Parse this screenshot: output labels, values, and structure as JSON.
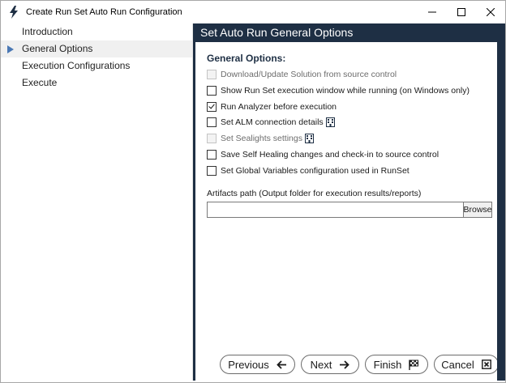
{
  "window": {
    "title": "Create Run Set Auto Run Configuration",
    "controls": [
      "minimize-icon",
      "maximize-icon",
      "close-icon"
    ]
  },
  "sidebar": {
    "items": [
      {
        "label": "Introduction",
        "active": false
      },
      {
        "label": "General Options",
        "active": true
      },
      {
        "label": "Execution Configurations",
        "active": false
      },
      {
        "label": "Execute",
        "active": false
      }
    ]
  },
  "main": {
    "header": "Set Auto Run General Options",
    "section_title": "General Options:",
    "options": [
      {
        "label": "Download/Update Solution from source control",
        "checked": false,
        "disabled": true
      },
      {
        "label": "Show Run Set execution window while running (on Windows only)",
        "checked": false,
        "disabled": false
      },
      {
        "label": "Run Analyzer before execution",
        "checked": true,
        "disabled": false
      },
      {
        "label": "Set ALM connection details",
        "checked": false,
        "disabled": false,
        "icon": "building-icon"
      },
      {
        "label": "Set Sealights settings",
        "checked": false,
        "disabled": true,
        "icon": "building-icon"
      },
      {
        "label": "Save Self Healing changes and check-in to source control",
        "checked": false,
        "disabled": false
      },
      {
        "label": "Set Global Variables configuration used in RunSet",
        "checked": false,
        "disabled": false
      }
    ],
    "artifacts": {
      "label": "Artifacts path (Output folder for execution results/reports)",
      "value": "",
      "browse_label": "Browse"
    }
  },
  "footer": {
    "previous_label": "Previous",
    "next_label": "Next",
    "finish_label": "Finish",
    "cancel_label": "Cancel"
  },
  "colors": {
    "accent_dark": "#1e2f44",
    "nav_arrow": "#4a78b4"
  }
}
